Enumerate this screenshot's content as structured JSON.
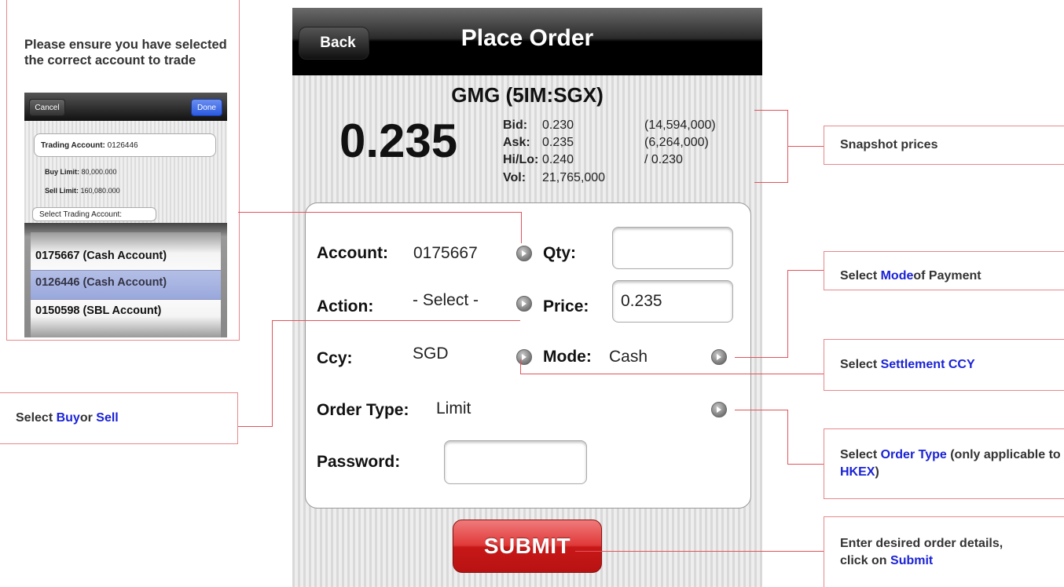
{
  "inset": {
    "note": "Please ensure you have selected the correct account to trade",
    "cancel": "Cancel",
    "done": "Done",
    "trading_account_label": "Trading Account:",
    "trading_account_value": "0126446",
    "buy_limit_label": "Buy Limit:",
    "buy_limit_value": "80,000.000",
    "sell_limit_label": "Sell Limit:",
    "sell_limit_value": "160,080.000",
    "select_account": "Select Trading Account:",
    "accounts": [
      "0175667 (Cash Account)",
      "0126446 (Cash Account)",
      "0150598 (SBL Account)"
    ]
  },
  "nav": {
    "back": "Back",
    "title": "Place Order"
  },
  "quote": {
    "name": "GMG (5IM:SGX)",
    "last": "0.235",
    "bid_label": "Bid:",
    "bid": "0.230",
    "bid_qty": "(14,594,000)",
    "ask_label": "Ask:",
    "ask": "0.235",
    "ask_qty": "(6,264,000)",
    "hilo_label": "Hi/Lo:",
    "hi": "0.240",
    "lo": "/ 0.230",
    "vol_label": "Vol:",
    "vol": "21,765,000"
  },
  "form": {
    "account_label": "Account:",
    "account_value": "0175667",
    "qty_label": "Qty:",
    "qty_value": "",
    "action_label": "Action:",
    "action_value": "- Select -",
    "price_label": "Price:",
    "price_value": "0.235",
    "ccy_label": "Ccy:",
    "ccy_value": "SGD",
    "mode_label": "Mode:",
    "mode_value": "Cash",
    "order_type_label": "Order Type:",
    "order_type_value": "Limit",
    "password_label": "Password:",
    "password_value": ""
  },
  "submit": "SUBMIT",
  "callouts": {
    "snapshot": "Snapshot prices",
    "mode_pre": "Select ",
    "mode_hl": "Mode",
    "mode_post": " of Payment",
    "ccy_pre": "Select ",
    "ccy_hl": "Settlement CCY",
    "ot_pre": "Select ",
    "ot_hl": "Order Type",
    "ot_mid": " (only applicable to ",
    "ot_hl2": "HKEX",
    "ot_post": ")",
    "submit_pre": "Enter desired order details, click on ",
    "submit_hl": "Submit",
    "buysell_pre": "Select ",
    "buysell_hl1": "Buy",
    "buysell_mid": " or ",
    "buysell_hl2": "Sell"
  }
}
